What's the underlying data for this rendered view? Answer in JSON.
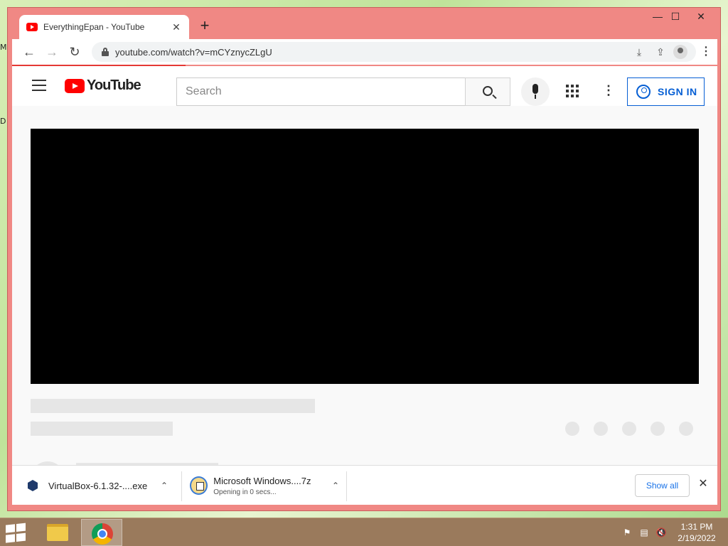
{
  "desktop": {
    "edge_label_1": "M",
    "edge_label_2": "D"
  },
  "browser": {
    "tab_title": "EverythingEpan - YouTube",
    "tab_close": "✕",
    "new_tab": "+",
    "window_controls": {
      "minimize": "—",
      "maximize": "☐",
      "close": "✕"
    },
    "nav": {
      "back": "←",
      "forward": "→",
      "reload": "↻"
    },
    "url": "youtube.com/watch?v=mCYznycZLgU",
    "menu": "⋮"
  },
  "youtube": {
    "logo_text": "YouTube",
    "search_placeholder": "Search",
    "more_label": "⋮",
    "sign_in_label": "SIGN IN"
  },
  "downloads": {
    "items": [
      {
        "name": "VirtualBox-6.1.32-....exe",
        "status": ""
      },
      {
        "name": "Microsoft Windows....7z",
        "status": "Opening in 0 secs..."
      }
    ],
    "chevron": "⌃",
    "show_all_label": "Show all",
    "close": "✕"
  },
  "taskbar": {
    "time": "1:31 PM",
    "date": "2/19/2022",
    "tray_icons": [
      "flag-icon",
      "network-icon",
      "volume-muted-icon"
    ]
  }
}
